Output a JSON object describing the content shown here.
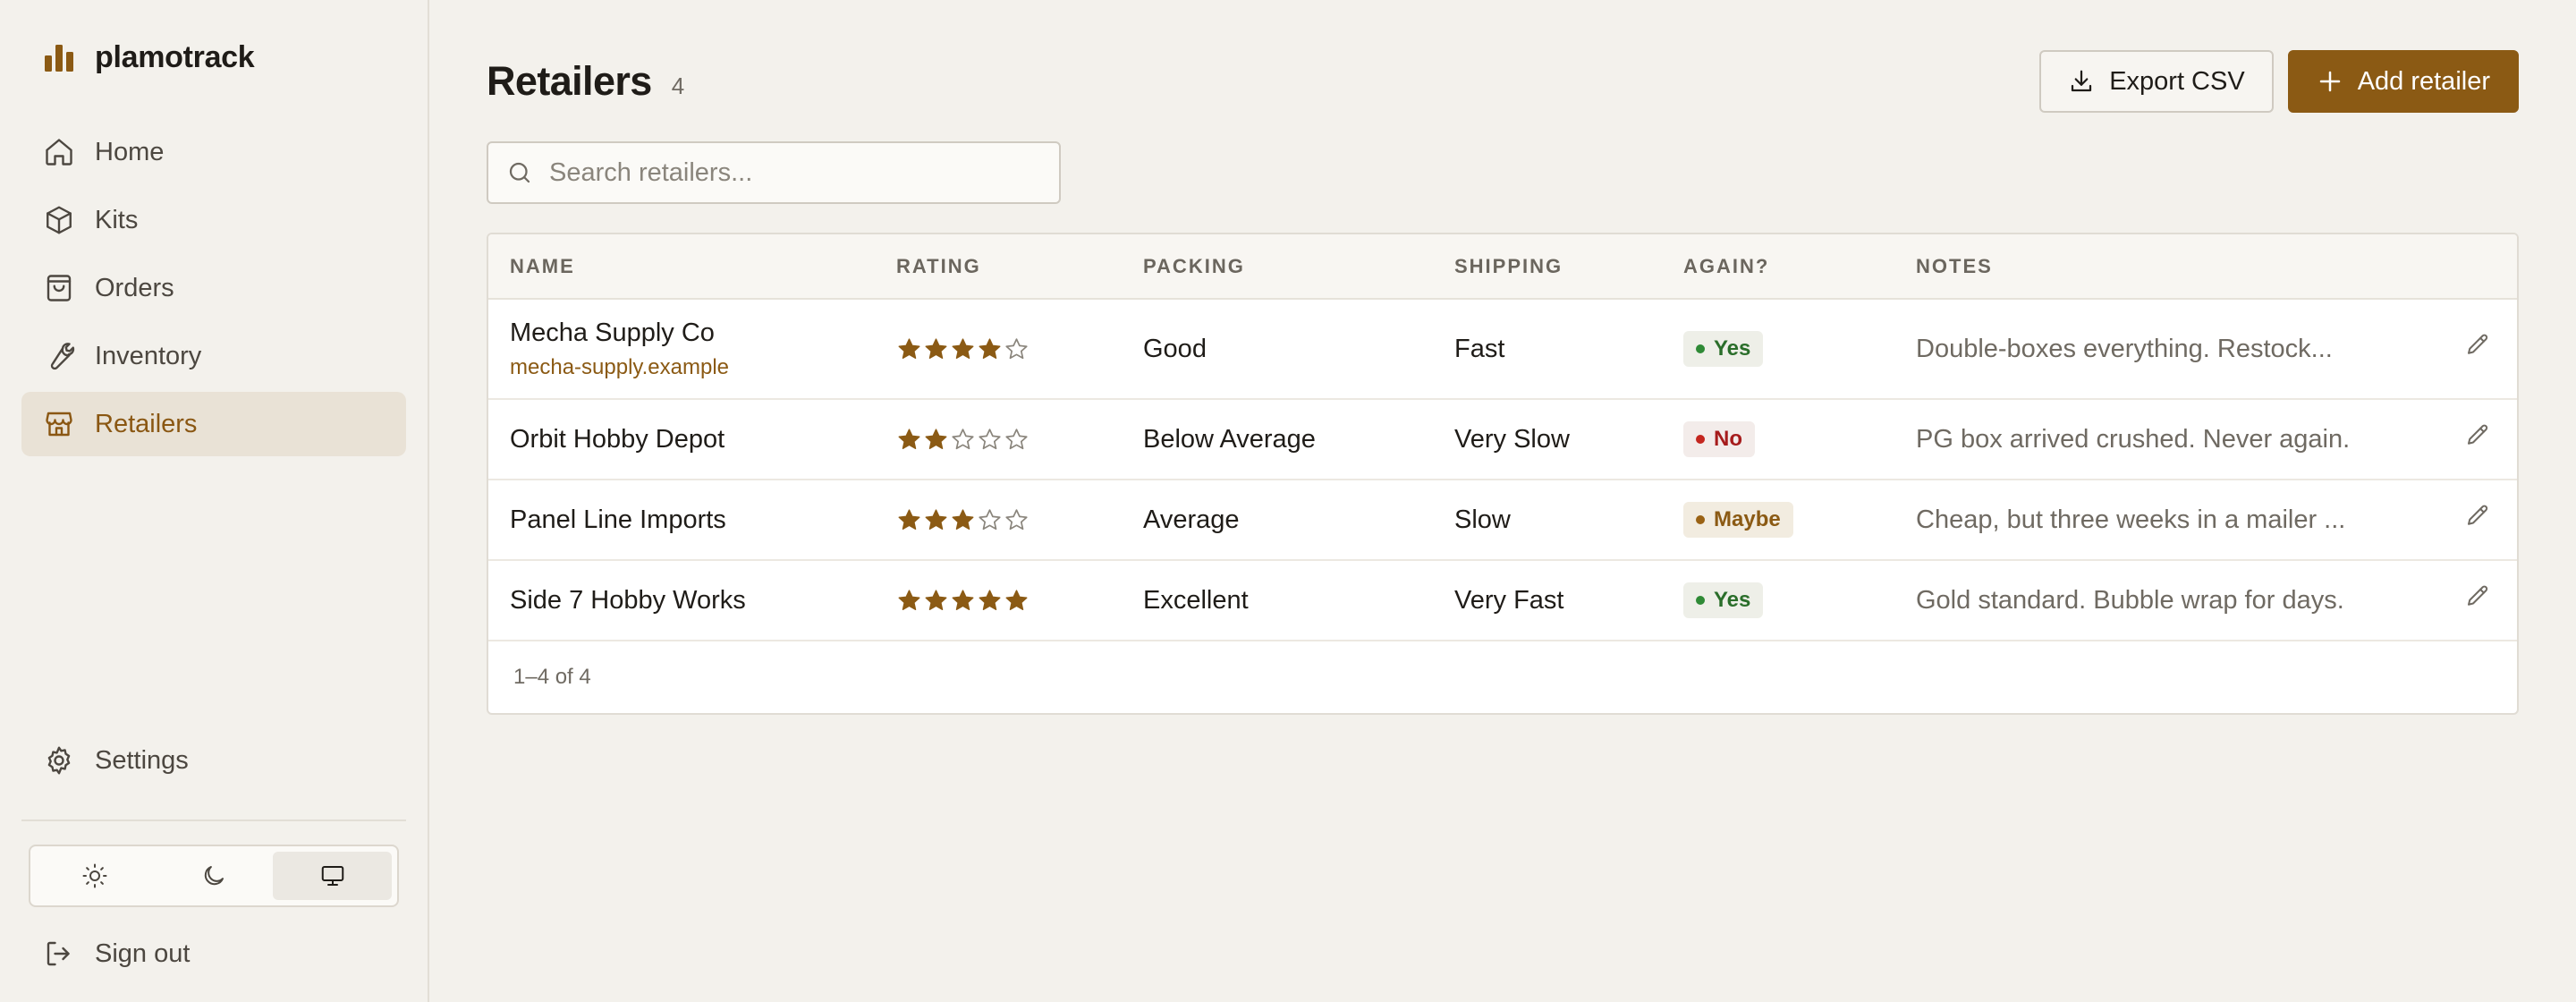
{
  "brand": {
    "name": "plamotrack",
    "accent": "#8b5a14"
  },
  "nav": {
    "items": [
      {
        "label": "Home",
        "icon": "home-icon"
      },
      {
        "label": "Kits",
        "icon": "box-icon"
      },
      {
        "label": "Orders",
        "icon": "shopping-bag-icon"
      },
      {
        "label": "Inventory",
        "icon": "wrench-icon"
      },
      {
        "label": "Retailers",
        "icon": "store-icon",
        "active": true
      }
    ],
    "settings_label": "Settings",
    "signout_label": "Sign out"
  },
  "theme": {
    "options": [
      "light",
      "dark",
      "system"
    ],
    "selected": "system"
  },
  "header": {
    "title": "Retailers",
    "count": "4",
    "export_label": "Export CSV",
    "add_label": "Add retailer"
  },
  "search": {
    "placeholder": "Search retailers...",
    "value": ""
  },
  "table": {
    "columns": [
      "NAME",
      "RATING",
      "PACKING",
      "SHIPPING",
      "AGAIN?",
      "NOTES"
    ],
    "rows": [
      {
        "name": "Mecha Supply Co",
        "url": "mecha-supply.example",
        "rating": 4,
        "packing": "Good",
        "shipping": "Fast",
        "again": "Yes",
        "again_status": "yes",
        "notes": "Double-boxes everything. Restock..."
      },
      {
        "name": "Orbit Hobby Depot",
        "url": "",
        "rating": 2,
        "packing": "Below Average",
        "shipping": "Very Slow",
        "again": "No",
        "again_status": "no",
        "notes": "PG box arrived crushed. Never again."
      },
      {
        "name": "Panel Line Imports",
        "url": "",
        "rating": 3,
        "packing": "Average",
        "shipping": "Slow",
        "again": "Maybe",
        "again_status": "maybe",
        "notes": "Cheap, but three weeks in a mailer ..."
      },
      {
        "name": "Side 7 Hobby Works",
        "url": "",
        "rating": 5,
        "packing": "Excellent",
        "shipping": "Very Fast",
        "again": "Yes",
        "again_status": "yes",
        "notes": "Gold standard. Bubble wrap for days."
      }
    ],
    "rating_max": 5,
    "footer": "1–4 of 4"
  }
}
